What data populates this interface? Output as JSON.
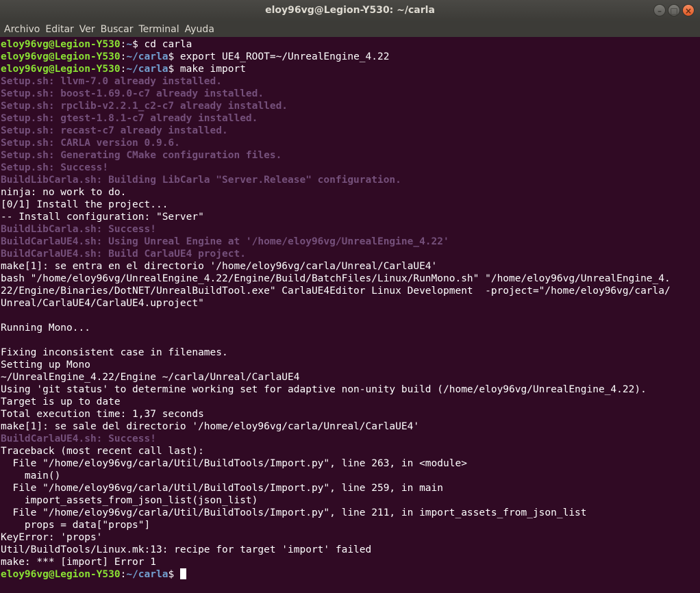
{
  "window": {
    "title": "eloy96vg@Legion-Y530: ~/carla",
    "buttons": [
      "–",
      "□",
      "×"
    ]
  },
  "menu": [
    "Archivo",
    "Editar",
    "Ver",
    "Buscar",
    "Terminal",
    "Ayuda"
  ],
  "prompt": {
    "user": "eloy96vg@Legion-Y530",
    "sep": ":"
  },
  "colors": {
    "background": "#300a24",
    "prompt_user": "#8ae234",
    "prompt_path": "#729fcf",
    "script_output": "#75507b",
    "text": "#ffffff"
  },
  "lines": [
    {
      "type": "prompt",
      "path": "~",
      "cmd": "$ cd carla"
    },
    {
      "type": "prompt",
      "path": "~/carla",
      "cmd": "$ export UE4_ROOT=~/UnrealEngine_4.22"
    },
    {
      "type": "prompt",
      "path": "~/carla",
      "cmd": "$ make import"
    },
    {
      "type": "setup",
      "text": "Setup.sh: llvm-7.0 already installed."
    },
    {
      "type": "setup",
      "text": "Setup.sh: boost-1.69.0-c7 already installed."
    },
    {
      "type": "setup",
      "text": "Setup.sh: rpclib-v2.2.1_c2-c7 already installed."
    },
    {
      "type": "setup",
      "text": "Setup.sh: gtest-1.8.1-c7 already installed."
    },
    {
      "type": "setup",
      "text": "Setup.sh: recast-c7 already installed."
    },
    {
      "type": "setup",
      "text": "Setup.sh: CARLA version 0.9.6."
    },
    {
      "type": "setup",
      "text": "Setup.sh: Generating CMake configuration files."
    },
    {
      "type": "setup",
      "text": "Setup.sh: Success!"
    },
    {
      "type": "setup",
      "text": "BuildLibCarla.sh: Building LibCarla \"Server.Release\" configuration."
    },
    {
      "type": "text",
      "text": "ninja: no work to do."
    },
    {
      "type": "text",
      "text": "[0/1] Install the project..."
    },
    {
      "type": "text",
      "text": "-- Install configuration: \"Server\""
    },
    {
      "type": "setup",
      "text": "BuildLibCarla.sh: Success!"
    },
    {
      "type": "setup",
      "text": "BuildCarlaUE4.sh: Using Unreal Engine at '/home/eloy96vg/UnrealEngine_4.22'"
    },
    {
      "type": "setup",
      "text": "BuildCarlaUE4.sh: Build CarlaUE4 project."
    },
    {
      "type": "text",
      "text": "make[1]: se entra en el directorio '/home/eloy96vg/carla/Unreal/CarlaUE4'"
    },
    {
      "type": "text",
      "text": "bash \"/home/eloy96vg/UnrealEngine_4.22/Engine/Build/BatchFiles/Linux/RunMono.sh\" \"/home/eloy96vg/UnrealEngine_4."
    },
    {
      "type": "text",
      "text": "22/Engine/Binaries/DotNET/UnrealBuildTool.exe\" CarlaUE4Editor Linux Development  -project=\"/home/eloy96vg/carla/"
    },
    {
      "type": "text",
      "text": "Unreal/CarlaUE4/CarlaUE4.uproject\""
    },
    {
      "type": "text",
      "text": ""
    },
    {
      "type": "text",
      "text": "Running Mono..."
    },
    {
      "type": "text",
      "text": ""
    },
    {
      "type": "text",
      "text": "Fixing inconsistent case in filenames."
    },
    {
      "type": "text",
      "text": "Setting up Mono"
    },
    {
      "type": "text",
      "text": "~/UnrealEngine_4.22/Engine ~/carla/Unreal/CarlaUE4"
    },
    {
      "type": "text",
      "text": "Using 'git status' to determine working set for adaptive non-unity build (/home/eloy96vg/UnrealEngine_4.22)."
    },
    {
      "type": "text",
      "text": "Target is up to date"
    },
    {
      "type": "text",
      "text": "Total execution time: 1,37 seconds"
    },
    {
      "type": "text",
      "text": "make[1]: se sale del directorio '/home/eloy96vg/carla/Unreal/CarlaUE4'"
    },
    {
      "type": "setup",
      "text": "BuildCarlaUE4.sh: Success!"
    },
    {
      "type": "text",
      "text": "Traceback (most recent call last):"
    },
    {
      "type": "text",
      "text": "  File \"/home/eloy96vg/carla/Util/BuildTools/Import.py\", line 263, in <module>"
    },
    {
      "type": "text",
      "text": "    main()"
    },
    {
      "type": "text",
      "text": "  File \"/home/eloy96vg/carla/Util/BuildTools/Import.py\", line 259, in main"
    },
    {
      "type": "text",
      "text": "    import_assets_from_json_list(json_list)"
    },
    {
      "type": "text",
      "text": "  File \"/home/eloy96vg/carla/Util/BuildTools/Import.py\", line 211, in import_assets_from_json_list"
    },
    {
      "type": "text",
      "text": "    props = data[\"props\"]"
    },
    {
      "type": "text",
      "text": "KeyError: 'props'"
    },
    {
      "type": "text",
      "text": "Util/BuildTools/Linux.mk:13: recipe for target 'import' failed"
    },
    {
      "type": "text",
      "text": "make: *** [import] Error 1"
    },
    {
      "type": "prompt",
      "path": "~/carla",
      "cmd": "$ ",
      "cursor": true
    }
  ]
}
